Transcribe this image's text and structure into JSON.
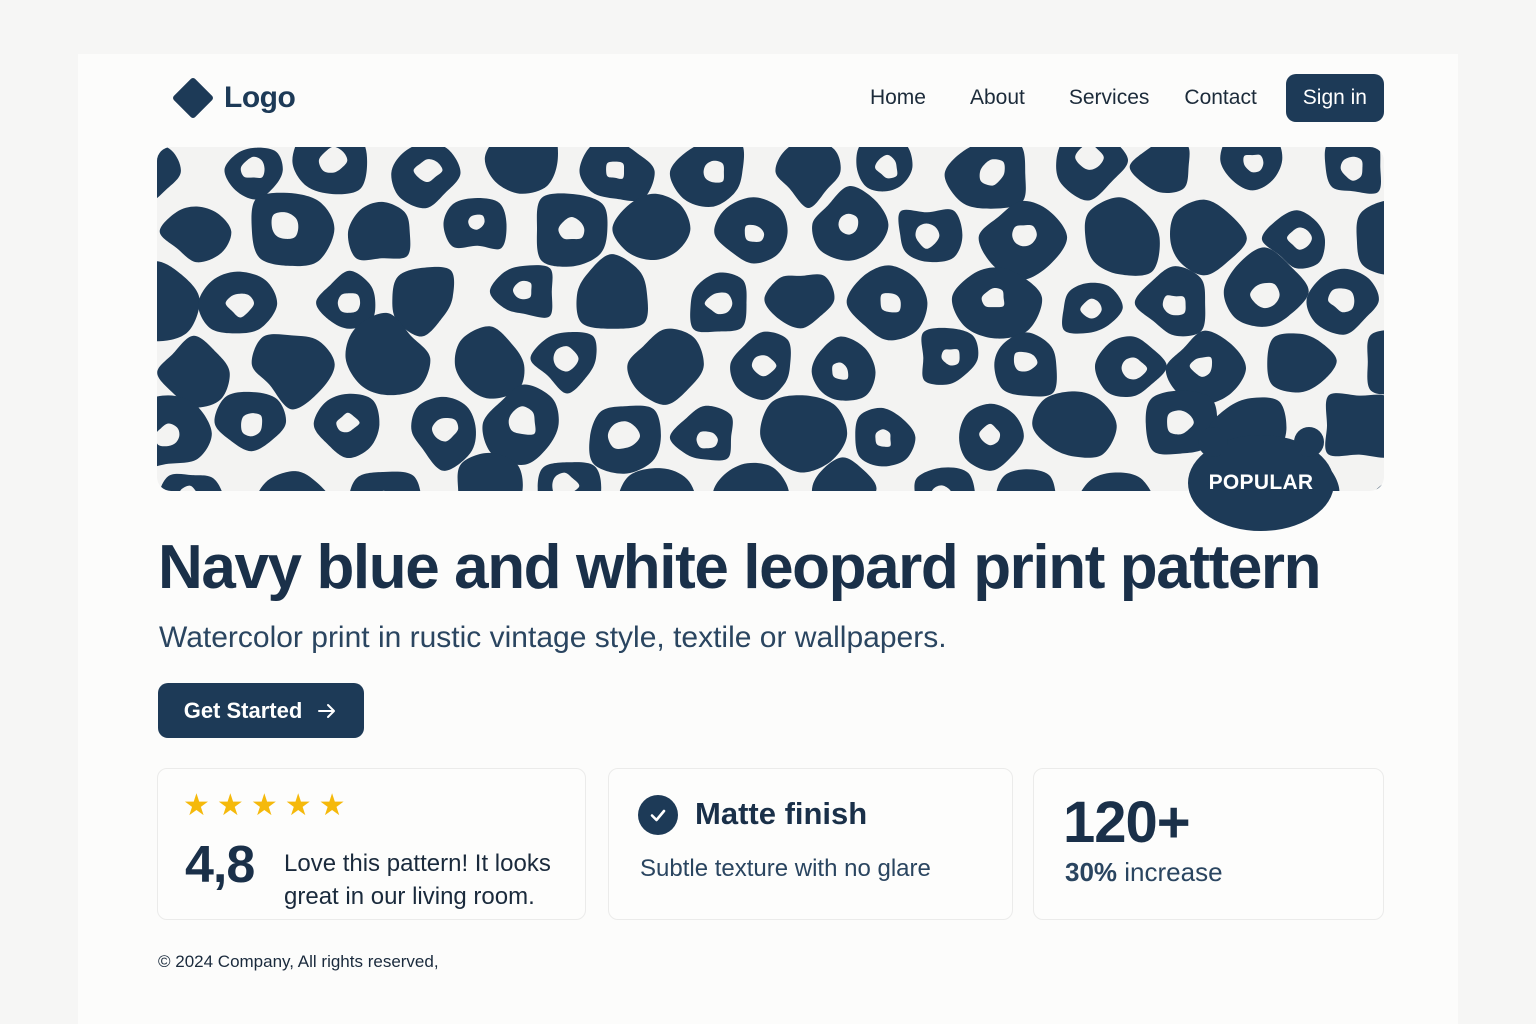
{
  "header": {
    "logo_text": "Logo",
    "nav": [
      "Home",
      "About",
      "Services",
      "Contact"
    ],
    "signin_label": "Sign in"
  },
  "hero": {
    "badge": "POPULAR",
    "title": "Navy blue and white leopard print pattern",
    "subtitle": "Watercolor print in rustic vintage style, textile or wallpapers.",
    "cta_label": "Get Started",
    "pattern_colors": {
      "spot": "#1d3a57",
      "background": "#f3f3f2"
    }
  },
  "cards": {
    "rating": {
      "stars": 5,
      "value": "4,8",
      "review": "Love this pattern! It looks great in our living room."
    },
    "feature": {
      "title": "Matte finish",
      "description": "Subtle texture with no glare"
    },
    "stat": {
      "value": "120+",
      "highlight": "30%",
      "label": "increase"
    }
  },
  "footer": {
    "copyright": "© 2024 Company, All rights reserved,"
  },
  "colors": {
    "primary": "#1d3a57",
    "star": "#f5b90b",
    "page": "#fcfcfb"
  },
  "icons": {
    "logo": "diamond-icon",
    "cta": "arrow-right-icon",
    "feature": "check-circle-icon",
    "rating": "star-icon"
  }
}
